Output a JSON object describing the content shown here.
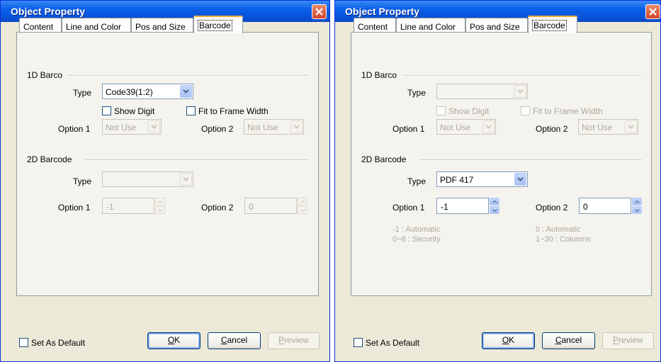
{
  "colors": {
    "title_bar": "#0a5fe8",
    "window_bg": "#ece9d8",
    "active_tab_accent": "#f6a93a",
    "disabled_text": "#aca899",
    "close_button": "#d2452a"
  },
  "dialogs": [
    {
      "title": "Object Property",
      "tabs": [
        "Content",
        "Line and Color",
        "Pos and Size",
        "Barcode"
      ],
      "active_tab": "Barcode",
      "barcode_1d": {
        "group_label": "1D Barco",
        "type_label": "Type",
        "type_value": "Code39(1:2)",
        "show_digit": "Show Digit",
        "fit_to_frame": "Fit to Frame Width",
        "option1_label": "Option 1",
        "option1_value": "Not Use",
        "option2_label": "Option 2",
        "option2_value": "Not Use",
        "enabled": true
      },
      "barcode_2d": {
        "group_label": "2D Barcode",
        "type_label": "Type",
        "type_value": "",
        "option1_label": "Option 1",
        "option1_value": "-1",
        "option2_label": "Option 2",
        "option2_value": "0",
        "enabled": false
      },
      "set_as_default": "Set As Default",
      "buttons": {
        "ok_prefix": "",
        "ok_mnemonic": "O",
        "ok_rest": "K",
        "cancel_mnemonic": "C",
        "cancel_rest": "ancel",
        "preview_mnemonic": "P",
        "preview_rest": "review"
      }
    },
    {
      "title": "Object Property",
      "tabs": [
        "Content",
        "Line and Color",
        "Pos and Size",
        "Barcode"
      ],
      "active_tab": "Barcode",
      "barcode_1d": {
        "group_label": "1D Barco",
        "type_label": "Type",
        "type_value": "",
        "show_digit": "Show Digit",
        "fit_to_frame": "Fit to Frame Width",
        "option1_label": "Option 1",
        "option1_value": "Not Use",
        "option2_label": "Option 2",
        "option2_value": "Not Use",
        "enabled": false
      },
      "barcode_2d": {
        "group_label": "2D Barcode",
        "type_label": "Type",
        "type_value": "PDF 417",
        "option1_label": "Option 1",
        "option1_value": "-1",
        "option2_label": "Option 2",
        "option2_value": "0",
        "enabled": true,
        "hint1_line1": "-1 : Automatic",
        "hint1_line2": "0~8 : Security",
        "hint2_line1": "0 : Automatic",
        "hint2_line2": "1~30 : Columns"
      },
      "set_as_default": "Set As Default",
      "buttons": {
        "ok_prefix": "",
        "ok_mnemonic": "O",
        "ok_rest": "K",
        "cancel_mnemonic": "C",
        "cancel_rest": "ancel",
        "preview_mnemonic": "P",
        "preview_rest": "review"
      }
    }
  ]
}
